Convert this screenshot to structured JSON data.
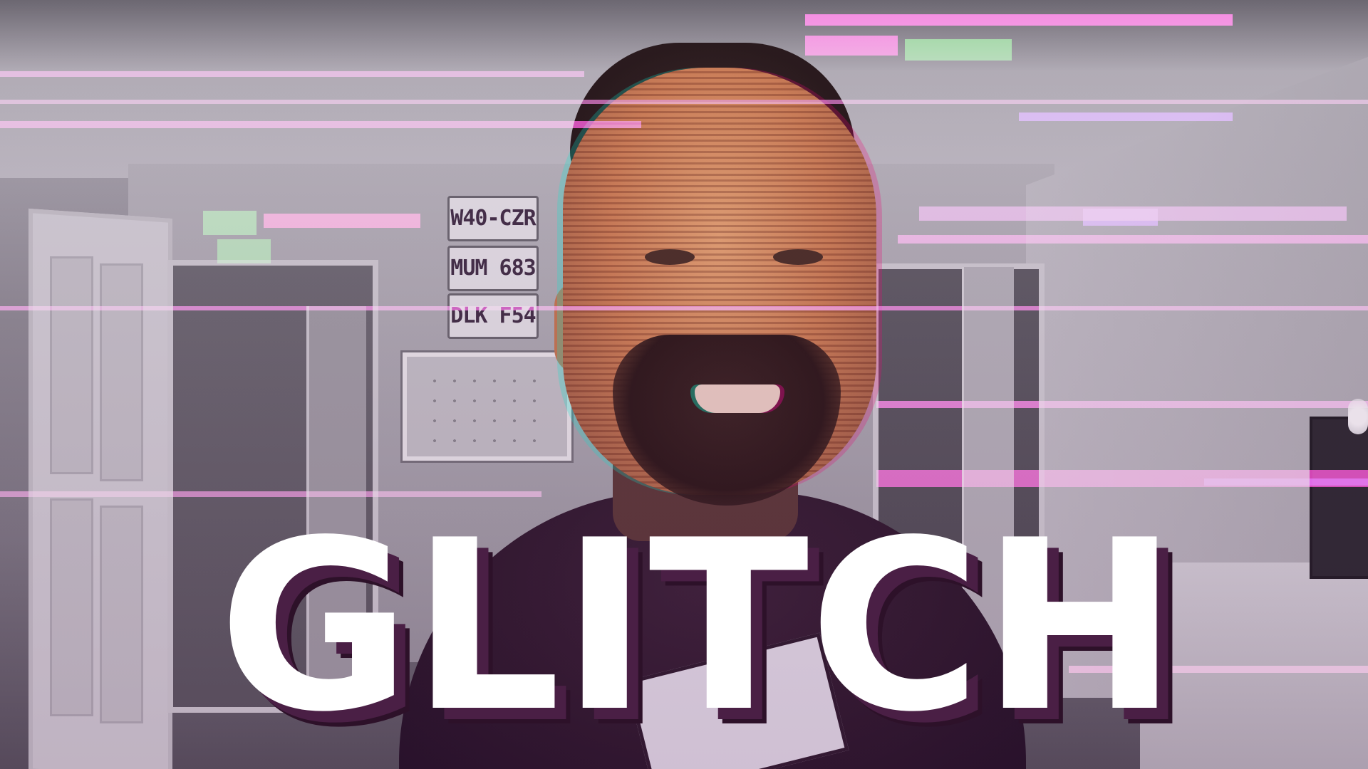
{
  "thumbnail": {
    "title": "GLITCH",
    "plates": [
      "W40-CZR",
      "MUM 683",
      "DLK F54"
    ],
    "colors": {
      "title_fill": "#ffffff",
      "title_shadow": "#4a1f45",
      "glitch_magenta": "#ff2fd0",
      "glitch_green": "#3cc83c",
      "glitch_violet": "#a040ff"
    }
  }
}
